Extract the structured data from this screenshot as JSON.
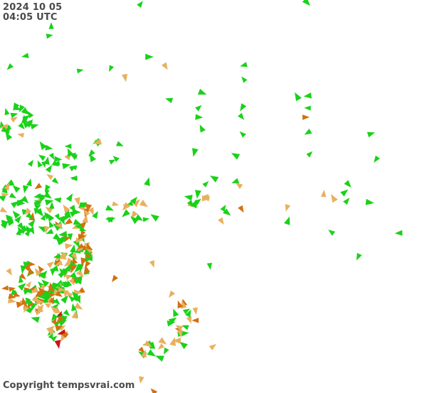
{
  "timestamp": {
    "date": "2024 10 05",
    "time": "04:05 UTC"
  },
  "copyright": "Copyright tempsvrai.com",
  "colors": {
    "green": "#19d219",
    "orange": "#e8b05e",
    "dark_orange": "#d4700e",
    "red": "#cc1414"
  },
  "map": {
    "type": "wind-direction-arrows",
    "region": "Eastern Australia / New Zealand / Southwest Pacific",
    "legend": "none shown"
  }
}
